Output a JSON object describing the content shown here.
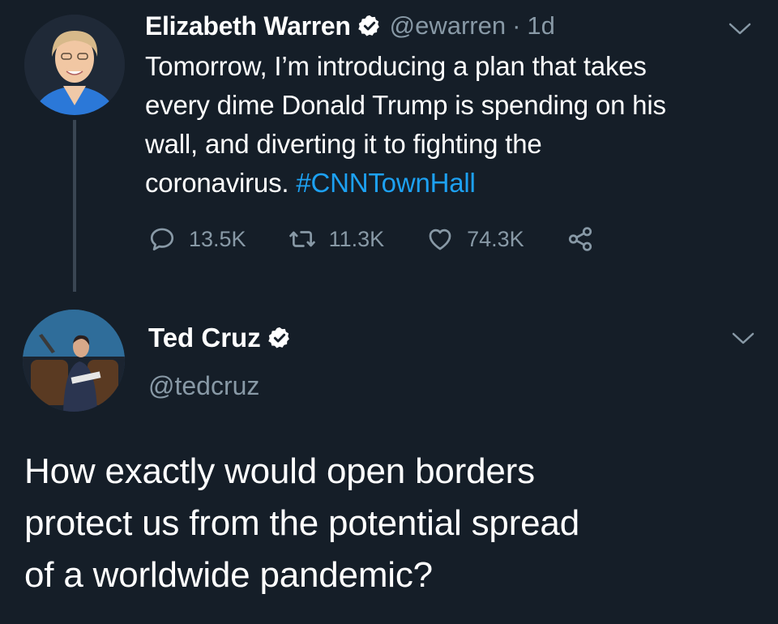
{
  "tweet1": {
    "name": "Elizabeth Warren",
    "handle": "@ewarren",
    "separator": "·",
    "time": "1d",
    "text_lines": [
      "Tomorrow, I’m introducing a plan that takes",
      "every dime Donald Trump is spending on his",
      "wall, and diverting it to fighting the"
    ],
    "text_last": "coronavirus.",
    "hashtag": "#CNNTownHall",
    "replies": "13.5K",
    "retweets": "11.3K",
    "likes": "74.3K"
  },
  "tweet2": {
    "name": "Ted Cruz",
    "handle": "@tedcruz",
    "text_lines": [
      "How exactly would open borders",
      "protect us from the potential spread",
      "of a worldwide pandemic?"
    ]
  },
  "colors": {
    "background": "#151e28",
    "secondary_text": "#8899a6",
    "link": "#1da1f2",
    "verified_badge": "#ffffff",
    "thread_line": "#3a4653"
  },
  "icons": {
    "reply": "reply-icon",
    "retweet": "retweet-icon",
    "like": "heart-icon",
    "share": "share-icon",
    "more": "chevron-down-icon",
    "verified": "verified-badge-icon"
  }
}
